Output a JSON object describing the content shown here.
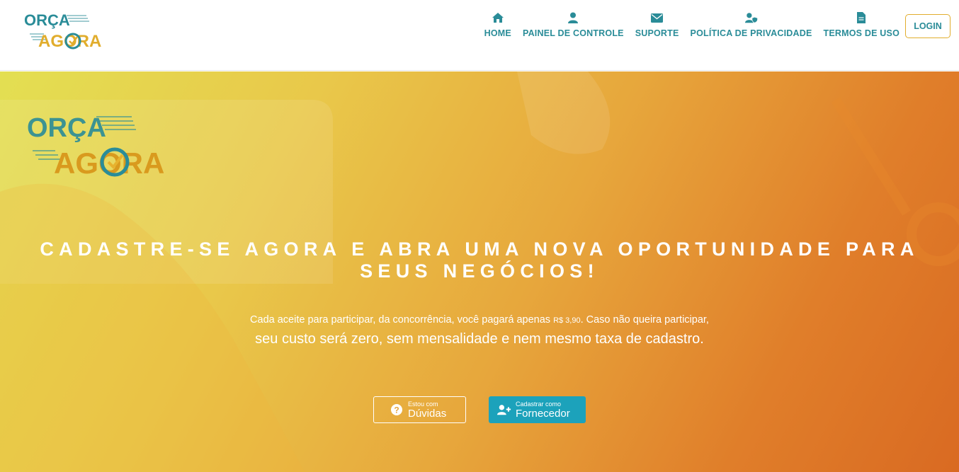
{
  "brand": {
    "logo_line1": "ORÇA",
    "logo_line2": "AGORA",
    "colors": {
      "teal": "#2a8c98",
      "gold": "#e1ad2d",
      "button_teal": "#1ca2bb"
    }
  },
  "nav": {
    "items": [
      {
        "label": "HOME",
        "icon": "home-icon"
      },
      {
        "label": "PAINEL DE CONTROLE",
        "icon": "user-icon"
      },
      {
        "label": "SUPORTE",
        "icon": "envelope-icon"
      },
      {
        "label": "POLÍTICA DE PRIVACIDADE",
        "icon": "user-shield-icon"
      },
      {
        "label": "TERMOS DE USO",
        "icon": "document-icon"
      }
    ],
    "login_label": "LOGIN"
  },
  "hero": {
    "headline": "CADASTRE-SE AGORA E ABRA UMA NOVA OPORTUNIDADE PARA SEUS NEGÓCIOS!",
    "sub1_before": "Cada aceite para participar, da concorrência, você pagará apenas ",
    "sub1_price": "R$ 3,90",
    "sub1_after": ". Caso não queira participar,",
    "sub2": "seu custo será zero, sem mensalidade e nem mesmo taxa de cadastro.",
    "buttons": {
      "duvidas": {
        "small": "Estou com",
        "big": "Dúvidas",
        "icon": "question-circle-icon"
      },
      "fornecedor": {
        "small": "Cadastrar como",
        "big": "Fornecedor",
        "icon": "user-plus-icon"
      }
    }
  }
}
